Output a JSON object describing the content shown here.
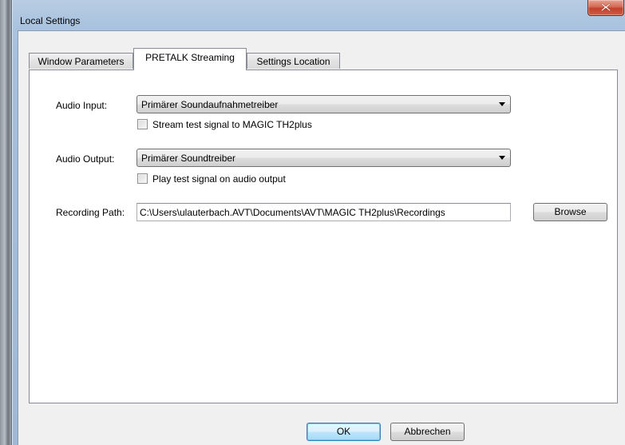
{
  "window": {
    "title": "Local Settings",
    "close_icon": "close-icon"
  },
  "tabs": [
    {
      "label": "Window Parameters",
      "active": false
    },
    {
      "label": "PRETALK Streaming",
      "active": true
    },
    {
      "label": "Settings Location",
      "active": false
    }
  ],
  "audio_input": {
    "label": "Audio Input:",
    "value": "Primärer Soundaufnahmetreiber",
    "checkbox_label": "Stream test signal to MAGIC TH2plus",
    "checked": false
  },
  "audio_output": {
    "label": "Audio Output:",
    "value": "Primärer Soundtreiber",
    "checkbox_label": "Play test signal on audio output",
    "checked": false
  },
  "recording": {
    "label": "Recording Path:",
    "value": "C:\\Users\\ulauterbach.AVT\\Documents\\AVT\\MAGIC TH2plus\\Recordings",
    "browse_label": "Browse"
  },
  "footer": {
    "ok_label": "OK",
    "cancel_label": "Abbrechen"
  },
  "colors": {
    "titlebar": "#aac3de",
    "close_button": "#c2402a",
    "dialog_bg": "#f0f0f0",
    "default_button": "#bee6fd"
  }
}
